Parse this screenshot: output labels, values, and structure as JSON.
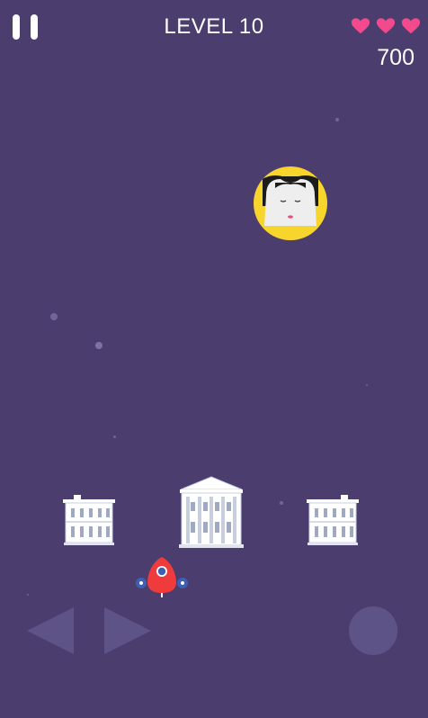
{
  "hud": {
    "level_label": "LEVEL 10",
    "score": "700",
    "lives": 3,
    "pause_icon": "pause-icon",
    "heart_icon": "heart-icon"
  },
  "enemy": {
    "icon": "portrait-face-icon",
    "badge_color": "#f8d52c"
  },
  "shields": [
    {
      "name": "small-building",
      "icon": "building-icon"
    },
    {
      "name": "white-house",
      "icon": "white-house-icon"
    },
    {
      "name": "small-building",
      "icon": "building-icon"
    }
  ],
  "player": {
    "icon": "rocket-ship-icon",
    "color": "#ef3b3b"
  },
  "controls": {
    "left_icon": "arrow-left-icon",
    "right_icon": "arrow-right-icon",
    "fire_icon": "fire-button-icon"
  },
  "colors": {
    "background": "#4b3d6e",
    "heart": "#f24a8c",
    "controls": "#5e5387",
    "text": "#ffffff"
  }
}
